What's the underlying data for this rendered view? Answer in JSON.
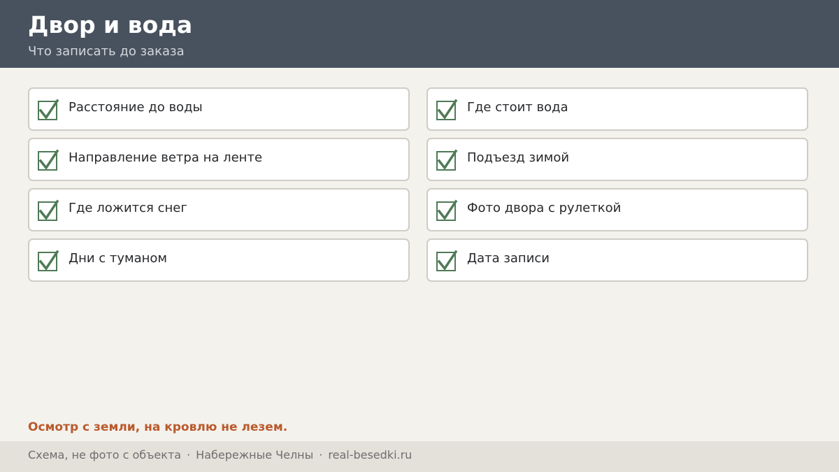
{
  "header": {
    "title": "Двор и вода",
    "subtitle": "Что записать до заказа"
  },
  "checklist": {
    "items": [
      {
        "label": "Расстояние до воды",
        "checked": true
      },
      {
        "label": "Где стоит вода",
        "checked": true
      },
      {
        "label": "Направление ветра на ленте",
        "checked": true
      },
      {
        "label": "Подъезд зимой",
        "checked": true
      },
      {
        "label": "Где ложится снег",
        "checked": true
      },
      {
        "label": "Фото двора с рулеткой",
        "checked": true
      },
      {
        "label": "Дни с туманом",
        "checked": true
      },
      {
        "label": "Дата записи",
        "checked": true
      }
    ],
    "check_icon": "checkmark-icon",
    "check_color": "#4f7a56"
  },
  "note": {
    "text": "Осмотр с земли, на кровлю не лезем.",
    "color": "#b95a2c"
  },
  "footer": {
    "parts": [
      "Схема, не фото с объекта",
      "Набережные Челны",
      "real-besedki.ru"
    ],
    "separator": "·"
  },
  "colors": {
    "header_bg": "#48525e",
    "page_bg": "#f4f2ed",
    "footer_bg": "#e4e1da"
  }
}
